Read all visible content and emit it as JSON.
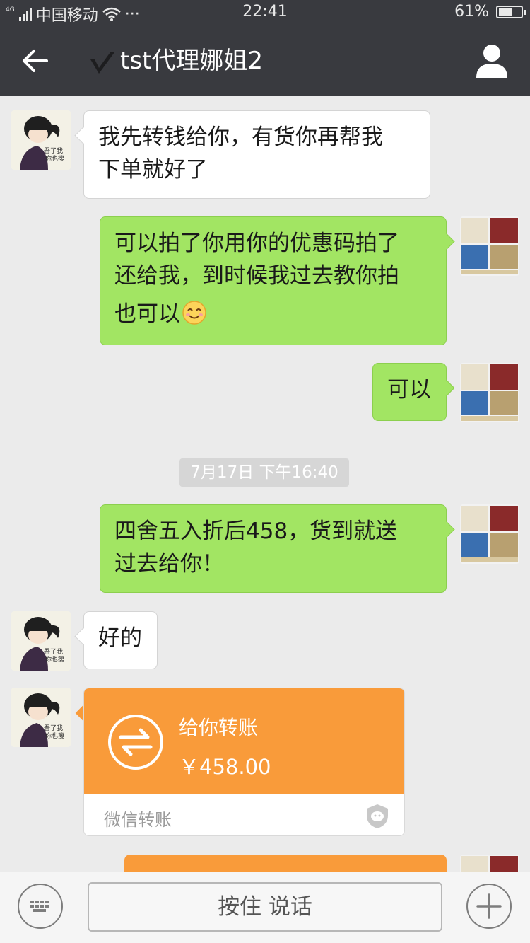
{
  "status_bar": {
    "network_type": "4G",
    "carrier": "中国移动",
    "more_dots": "···",
    "time": "22:41",
    "battery_percent_text": "61%",
    "battery_level": 0.61
  },
  "header": {
    "title": "tst代理娜姐2",
    "back_icon": "arrow-left-icon",
    "profile_icon": "person-icon"
  },
  "messages": [
    {
      "side": "in",
      "text_line1": "我先转钱给你，有货你再帮我",
      "text_line2": "下单就好了"
    },
    {
      "side": "out",
      "text_line1": "可以拍了你用你的优惠码拍了",
      "text_line2": "还给我，到时候我过去教你拍",
      "text_line3": "也可以",
      "emoji": "smile-emoji"
    },
    {
      "side": "out",
      "text": "可以"
    },
    {
      "side": "out",
      "text_line1": "四舍五入折后458，货到就送",
      "text_line2": "过去给你！"
    },
    {
      "side": "in",
      "text": "好的"
    }
  ],
  "timestamp": "7月17日 下午16:40",
  "transfer": {
    "title": "给你转账",
    "amount": "￥458.00",
    "footer_label": "微信转账",
    "color": "#f99b3a"
  },
  "input_bar": {
    "hold_to_talk": "按住 说话",
    "keyboard_icon": "keyboard-icon",
    "plus_icon": "plus-icon"
  },
  "colors": {
    "bar": "#393a3f",
    "outgoing_bubble": "#a2e563",
    "incoming_bubble": "#ffffff",
    "chat_bg": "#ebebeb"
  }
}
